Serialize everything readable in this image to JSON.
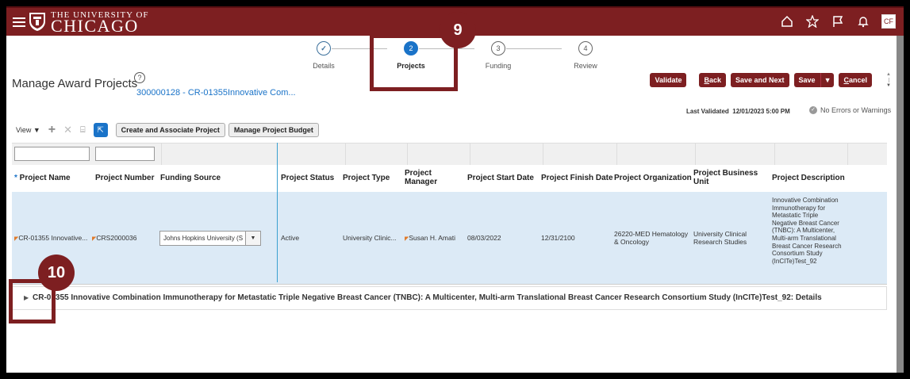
{
  "header": {
    "university_line1": "THE UNIVERSITY OF",
    "university_line2": "CHICAGO",
    "avatar": "CF",
    "icons": [
      "home-icon",
      "star-icon",
      "flag-icon",
      "bell-icon"
    ]
  },
  "train": {
    "steps": [
      {
        "num": "✓",
        "label": "Details",
        "state": "done"
      },
      {
        "num": "2",
        "label": "Projects",
        "state": "current"
      },
      {
        "num": "3",
        "label": "Funding",
        "state": "todo"
      },
      {
        "num": "4",
        "label": "Review",
        "state": "todo"
      }
    ]
  },
  "callouts": {
    "c9": "9",
    "c10": "10"
  },
  "page": {
    "title": "Manage Award Projects",
    "help": "?",
    "award_link": "300000128 - CR-01355Innovative Com..."
  },
  "actions": {
    "validate": "Validate",
    "back": "Back",
    "save_next": "Save and Next",
    "save": "Save",
    "cancel": "Cancel"
  },
  "status": {
    "last_validated_label": "Last Validated",
    "last_validated_value": "12/01/2023 5:00 PM",
    "no_errors": "No Errors or Warnings"
  },
  "toolbar": {
    "view": "View ▼",
    "create_associate": "Create and Associate Project",
    "manage_budget": "Manage Project Budget"
  },
  "table": {
    "headers": [
      "* Project Name",
      "Project Number",
      "Funding Source",
      "Project Status",
      "Project Type",
      "Project Manager",
      "Project Start Date",
      "Project Finish Date",
      "Project Organization",
      "Project Business Unit",
      "Project Description"
    ],
    "row": {
      "name": "CR-01355 Innovative...",
      "number": "CRS2000036",
      "funding": "Johns Hopkins University (S",
      "status": "Active",
      "type": "University Clinic...",
      "manager": "Susan H. Amati",
      "start": "08/03/2022",
      "finish": "12/31/2100",
      "organization": "26220-MED Hematology & Oncology",
      "business_unit": "University Clinical Research Studies",
      "description": "Innovative Combination Immunotherapy for Metastatic Triple Negative Breast Cancer (TNBC): A Multicenter, Multi-arm Translational Breast Cancer Research Consortium Study (InCITe)Test_92"
    }
  },
  "details": {
    "text": "CR-01355 Innovative Combination Immunotherapy for Metastatic Triple Negative Breast Cancer (TNBC): A Multicenter, Multi-arm Translational Breast Cancer Research Consortium Study (InCITe)Test_92: Details"
  }
}
